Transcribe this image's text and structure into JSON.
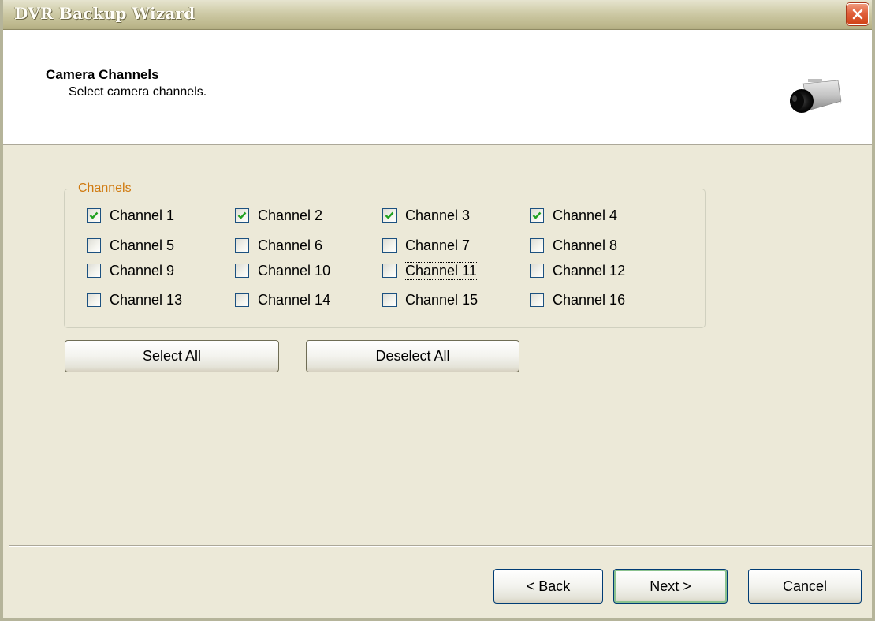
{
  "window": {
    "title": "DVR Backup Wizard"
  },
  "header": {
    "title": "Camera Channels",
    "subtitle": "Select camera channels.",
    "icon": "camera-icon"
  },
  "channels_group": {
    "label": "Channels",
    "items": [
      {
        "label": "Channel 1",
        "checked": true
      },
      {
        "label": "Channel 2",
        "checked": true
      },
      {
        "label": "Channel 3",
        "checked": true
      },
      {
        "label": "Channel 4",
        "checked": true
      },
      {
        "label": "Channel 5",
        "checked": false
      },
      {
        "label": "Channel 6",
        "checked": false
      },
      {
        "label": "Channel 7",
        "checked": false
      },
      {
        "label": "Channel 8",
        "checked": false
      },
      {
        "label": "Channel 9",
        "checked": false
      },
      {
        "label": "Channel 10",
        "checked": false
      },
      {
        "label": "Channel 11",
        "checked": false,
        "focused": true
      },
      {
        "label": "Channel 12",
        "checked": false
      },
      {
        "label": "Channel 13",
        "checked": false
      },
      {
        "label": "Channel 14",
        "checked": false
      },
      {
        "label": "Channel 15",
        "checked": false
      },
      {
        "label": "Channel 16",
        "checked": false
      }
    ]
  },
  "actions": {
    "select_all": "Select All",
    "deselect_all": "Deselect All"
  },
  "footer": {
    "back": "< Back",
    "next": "Next >",
    "cancel": "Cancel"
  },
  "colors": {
    "group_label": "#d07a10",
    "check": "#21a121",
    "close_button": "#e0603c"
  }
}
